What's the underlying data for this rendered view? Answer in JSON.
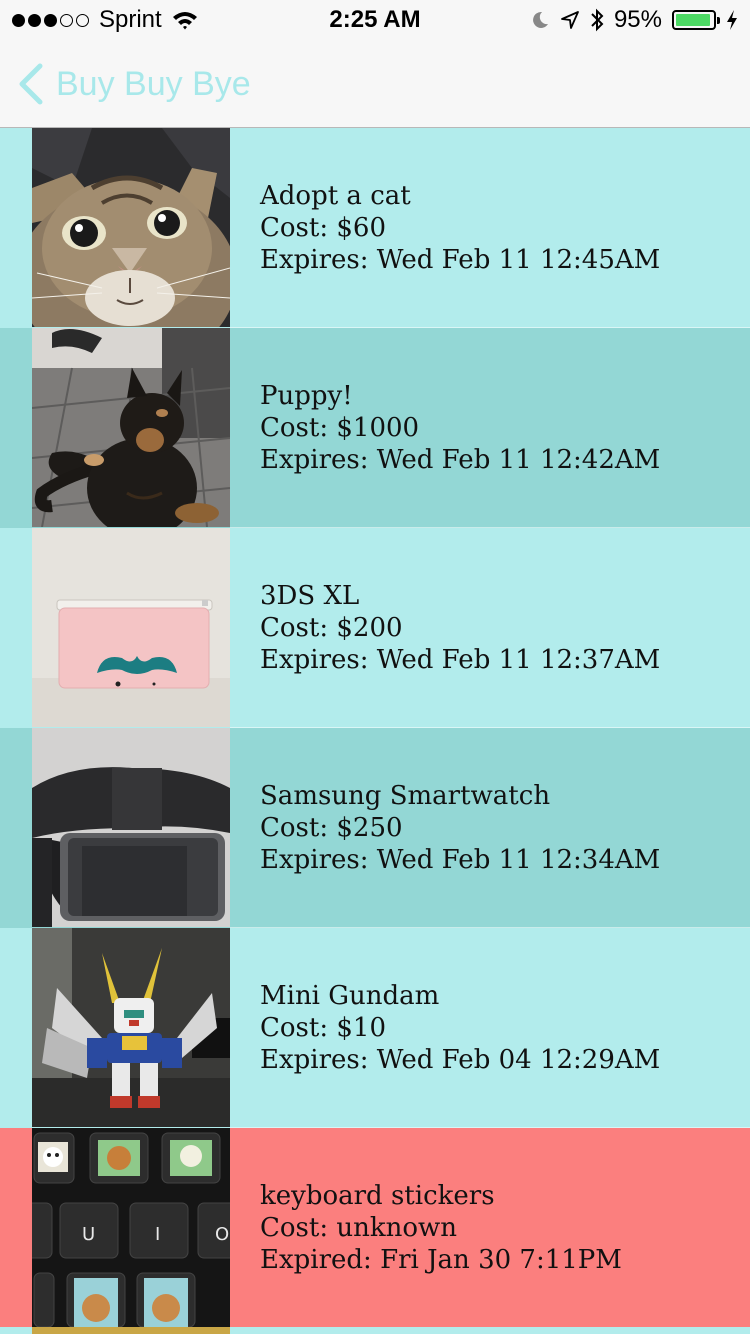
{
  "status_bar": {
    "carrier": "Sprint",
    "time": "2:25 AM",
    "battery": "95%",
    "battery_level": 0.95
  },
  "nav": {
    "back_label": "Buy Buy Bye"
  },
  "colors": {
    "light_row": "#b2ecec",
    "dark_row": "#93d7d5",
    "expired_row": "#fb7f7e",
    "accent": "#a8e8ea"
  },
  "items": [
    {
      "title": "Adopt a cat",
      "cost": "Cost: $60",
      "expires": "Expires: Wed Feb 11 12:45AM",
      "image": "cat-photo"
    },
    {
      "title": "Puppy!",
      "cost": "Cost: $1000",
      "expires": "Expires: Wed Feb 11 12:42AM",
      "image": "dog-photo"
    },
    {
      "title": "3DS XL",
      "cost": "Cost: $200",
      "expires": "Expires: Wed Feb 11 12:37AM",
      "image": "3ds-photo"
    },
    {
      "title": "Samsung Smartwatch",
      "cost": "Cost: $250",
      "expires": "Expires: Wed Feb 11 12:34AM",
      "image": "smartwatch-photo"
    },
    {
      "title": "Mini Gundam",
      "cost": "Cost: $10",
      "expires": "Expires: Wed Feb 04 12:29AM",
      "image": "gundam-photo"
    },
    {
      "title": "keyboard stickers",
      "cost": "Cost: unknown",
      "expires": "Expired: Fri Jan 30 7:11PM",
      "image": "keyboard-photo"
    }
  ]
}
